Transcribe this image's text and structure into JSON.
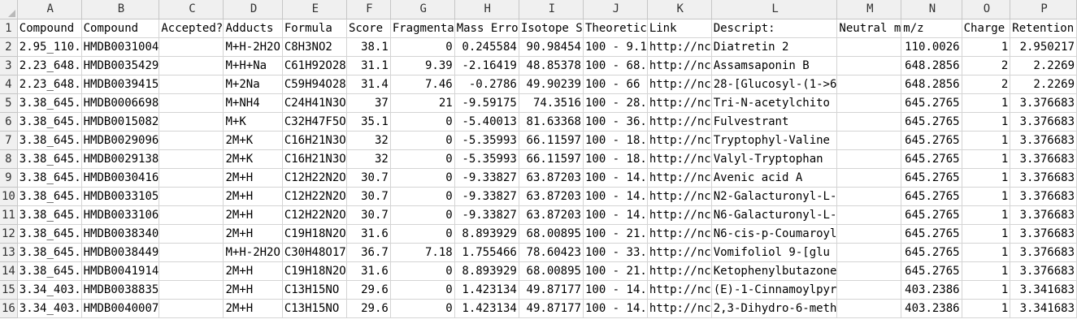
{
  "columns": [
    "A",
    "B",
    "C",
    "D",
    "E",
    "F",
    "G",
    "H",
    "I",
    "J",
    "K",
    "L",
    "M",
    "N",
    "O",
    "P"
  ],
  "rows": [
    [
      "1",
      "Compound",
      "Compound",
      "Accepted?",
      "Adducts",
      "Formula",
      "Score",
      "Fragmenta",
      "Mass Erro",
      "Isotope S",
      "Theoretic",
      "Link",
      "Descript:",
      "Neutral m",
      "m/z",
      "Charge",
      "Retention"
    ],
    [
      "2",
      "2.95_110.",
      "HMDB0031004",
      "",
      "M+H-2H2O",
      "C8H3NO2",
      "38.1",
      "0",
      "0.245584",
      "90.98454",
      "100 - 9.1",
      "http://nc",
      "Diatretin 2",
      "",
      "110.0026",
      "1",
      "2.950217"
    ],
    [
      "3",
      "2.23_648.",
      "HMDB0035429",
      "",
      "M+H+Na",
      "C61H92O28",
      "31.1",
      "9.39",
      "-2.16419",
      "48.85378",
      "100 - 68.",
      "http://nc",
      "Assamsaponin B",
      "",
      "648.2856",
      "2",
      "2.2269"
    ],
    [
      "4",
      "2.23_648.",
      "HMDB0039415",
      "",
      "M+2Na",
      "C59H94O28",
      "31.4",
      "7.46",
      "-0.2786",
      "49.90239",
      "100 - 66",
      "http://nc",
      "28-[Glucosyl-(1->6",
      "",
      "648.2856",
      "2",
      "2.2269"
    ],
    [
      "5",
      "3.38_645.",
      "HMDB0006698",
      "",
      "M+NH4",
      "C24H41N3O",
      "37",
      "21",
      "-9.59175",
      "74.3516",
      "100 - 28.",
      "http://nc",
      "Tri-N-acetylchito",
      "",
      "645.2765",
      "1",
      "3.376683"
    ],
    [
      "6",
      "3.38_645.",
      "HMDB0015082",
      "",
      "M+K",
      "C32H47F5O",
      "35.1",
      "0",
      "-5.40013",
      "81.63368",
      "100 - 36.",
      "http://nc",
      "Fulvestrant",
      "",
      "645.2765",
      "1",
      "3.376683"
    ],
    [
      "7",
      "3.38_645.",
      "HMDB0029096",
      "",
      "2M+K",
      "C16H21N3O",
      "32",
      "0",
      "-5.35993",
      "66.11597",
      "100 - 18.",
      "http://nc",
      "Tryptophyl-Valine",
      "",
      "645.2765",
      "1",
      "3.376683"
    ],
    [
      "8",
      "3.38_645.",
      "HMDB0029138",
      "",
      "2M+K",
      "C16H21N3O",
      "32",
      "0",
      "-5.35993",
      "66.11597",
      "100 - 18.",
      "http://nc",
      "Valyl-Tryptophan",
      "",
      "645.2765",
      "1",
      "3.376683"
    ],
    [
      "9",
      "3.38_645.",
      "HMDB0030416",
      "",
      "2M+H",
      "C12H22N2O",
      "30.7",
      "0",
      "-9.33827",
      "63.87203",
      "100 - 14.",
      "http://nc",
      "Avenic acid A",
      "",
      "645.2765",
      "1",
      "3.376683"
    ],
    [
      "10",
      "3.38_645.",
      "HMDB0033105",
      "",
      "2M+H",
      "C12H22N2O",
      "30.7",
      "0",
      "-9.33827",
      "63.87203",
      "100 - 14.",
      "http://nc",
      "N2-Galacturonyl-L-",
      "",
      "645.2765",
      "1",
      "3.376683"
    ],
    [
      "11",
      "3.38_645.",
      "HMDB0033106",
      "",
      "2M+H",
      "C12H22N2O",
      "30.7",
      "0",
      "-9.33827",
      "63.87203",
      "100 - 14.",
      "http://nc",
      "N6-Galacturonyl-L-",
      "",
      "645.2765",
      "1",
      "3.376683"
    ],
    [
      "12",
      "3.38_645.",
      "HMDB0038340",
      "",
      "2M+H",
      "C19H18N2O",
      "31.6",
      "0",
      "8.893929",
      "68.00895",
      "100 - 21.",
      "http://nc",
      "N6-cis-p-Coumaroyl",
      "",
      "645.2765",
      "1",
      "3.376683"
    ],
    [
      "13",
      "3.38_645.",
      "HMDB0038449",
      "",
      "M+H-2H2O",
      "C30H48O17",
      "36.7",
      "7.18",
      "1.755466",
      "78.60423",
      "100 - 33.",
      "http://nc",
      "Vomifoliol 9-[glu",
      "",
      "645.2765",
      "1",
      "3.376683"
    ],
    [
      "14",
      "3.38_645.",
      "HMDB0041914",
      "",
      "2M+H",
      "C19H18N2O",
      "31.6",
      "0",
      "8.893929",
      "68.00895",
      "100 - 21.",
      "http://nc",
      "Ketophenylbutazone",
      "",
      "645.2765",
      "1",
      "3.376683"
    ],
    [
      "15",
      "3.34_403.",
      "HMDB0038835",
      "",
      "2M+H",
      "C13H15NO",
      "29.6",
      "0",
      "1.423134",
      "49.87177",
      "100 - 14.",
      "http://nc",
      "(E)-1-Cinnamoylpyr",
      "",
      "403.2386",
      "1",
      "3.341683"
    ],
    [
      "16",
      "3.34_403.",
      "HMDB0040007",
      "",
      "2M+H",
      "C13H15NO",
      "29.6",
      "0",
      "1.423134",
      "49.87177",
      "100 - 14.",
      "http://nc",
      "2,3-Dihydro-6-meth",
      "",
      "403.2386",
      "1",
      "3.341683"
    ]
  ]
}
